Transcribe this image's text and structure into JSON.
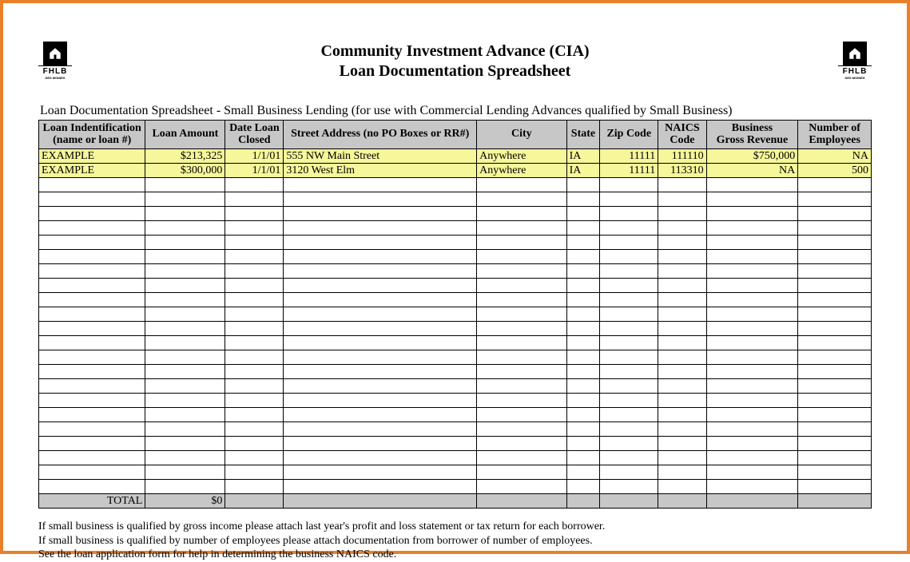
{
  "title_line1": "Community Investment Advance (CIA)",
  "title_line2": "Loan Documentation Spreadsheet",
  "logo_label": "FHLB",
  "logo_sub": "DES MOINES",
  "caption": "Loan Documentation Spreadsheet - Small Business Lending (for use with Commercial Lending Advances qualified by Small Business)",
  "columns": [
    {
      "l1": "Loan Indentification",
      "l2": "(name or loan #)"
    },
    {
      "l1": "",
      "l2": "Loan Amount"
    },
    {
      "l1": "Date Loan",
      "l2": "Closed"
    },
    {
      "l1": "",
      "l2": "Street Address (no PO Boxes or RR#)"
    },
    {
      "l1": "",
      "l2": "City"
    },
    {
      "l1": "",
      "l2": "State"
    },
    {
      "l1": "",
      "l2": "Zip Code"
    },
    {
      "l1": "NAICS",
      "l2": "Code"
    },
    {
      "l1": "Business",
      "l2": "Gross Revenue"
    },
    {
      "l1": "Number of",
      "l2": "Employees"
    }
  ],
  "rows": [
    {
      "loanid": "EXAMPLE",
      "amount": "$213,325",
      "date": "1/1/01",
      "addr": "555 NW Main Street",
      "city": "Anywhere",
      "state": "IA",
      "zip": "11111",
      "naics": "111110",
      "revenue": "$750,000",
      "emp": "NA"
    },
    {
      "loanid": "EXAMPLE",
      "amount": "$300,000",
      "date": "1/1/01",
      "addr": "3120 West Elm",
      "city": "Anywhere",
      "state": "IA",
      "zip": "11111",
      "naics": "113310",
      "revenue": "NA",
      "emp": "500"
    }
  ],
  "empty_rows": 22,
  "total_label": "TOTAL",
  "total_value": "$0",
  "notes": [
    "If small business is qualified by gross income please attach last year's profit and loss statement or tax return for each borrower.",
    "If small business is qualified by number of employees please attach documentation from borrower of number of employees.",
    "See the loan application form for help in determining the business NAICS code."
  ]
}
